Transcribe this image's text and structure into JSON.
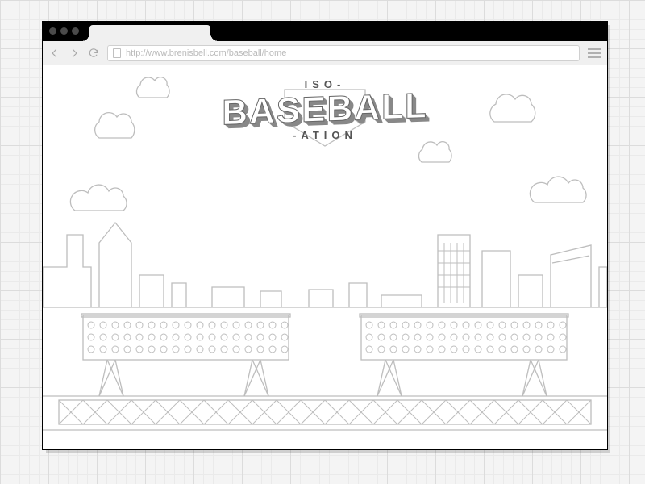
{
  "browser": {
    "url": "http://www.brenisbell.com/baseball/home"
  },
  "page": {
    "title_top": "ISO-",
    "title_main": "BASEBALL",
    "title_bottom": "-ATION"
  }
}
